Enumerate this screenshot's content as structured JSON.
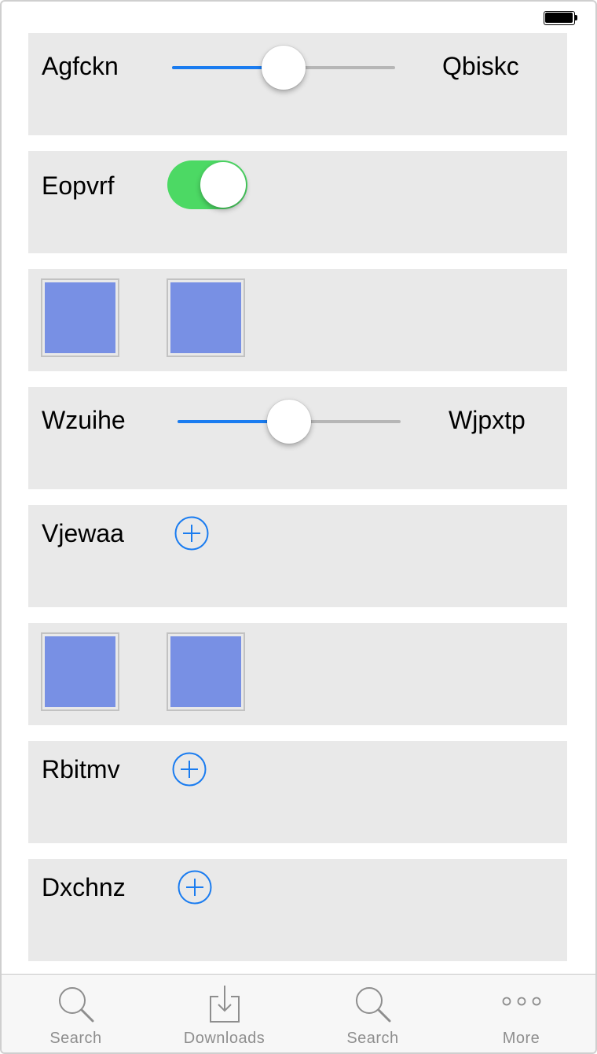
{
  "status_bar": {
    "battery_icon": "battery-full-icon"
  },
  "rows": {
    "slider1": {
      "left_label": "Agfckn",
      "right_label": "Qbiskc",
      "value": 0.5
    },
    "switch1": {
      "label": "Eopvrf",
      "on": true
    },
    "tiles1": {
      "color": "#7890e4"
    },
    "slider2": {
      "left_label": "Wzuihe",
      "right_label": "Wjpxtp",
      "value": 0.5
    },
    "add1": {
      "label": "Vjewaa",
      "icon": "add-circle-icon"
    },
    "tiles2": {
      "color": "#7890e4"
    },
    "add2": {
      "label": "Rbitmv",
      "icon": "add-circle-icon"
    },
    "add3": {
      "label": "Dxchnz",
      "icon": "add-circle-icon"
    }
  },
  "colors": {
    "accent": "#1a7cf0",
    "switch_on": "#4cd964",
    "row_bg": "#e9e9e9",
    "tab_inactive": "#8e8e8e"
  },
  "tabbar": {
    "tabs": [
      {
        "label": "Search",
        "icon": "search-icon"
      },
      {
        "label": "Downloads",
        "icon": "downloads-icon"
      },
      {
        "label": "Search",
        "icon": "search-icon"
      },
      {
        "label": "More",
        "icon": "more-icon"
      }
    ]
  }
}
